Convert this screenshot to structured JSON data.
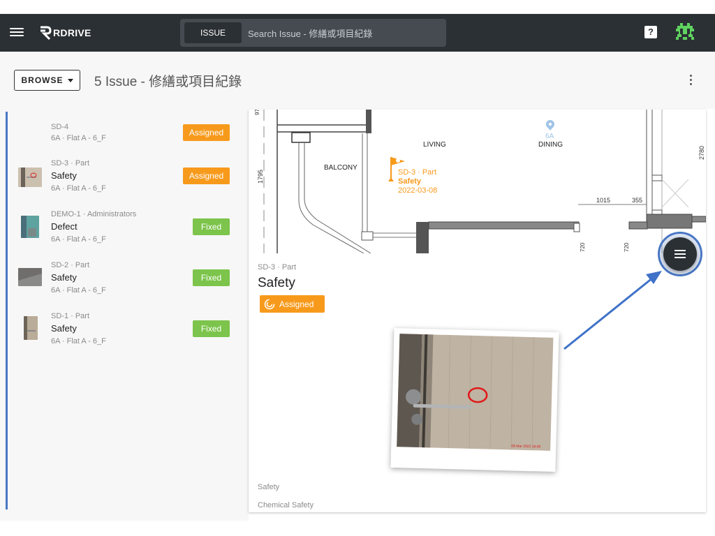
{
  "appbar": {
    "logo_text": "RDRIVE",
    "search_chip": "ISSUE",
    "search_placeholder": "Search Issue - 修繕或項目紀錄",
    "help_label": "?"
  },
  "subheader": {
    "browse_label": "BROWSE",
    "title": "5 Issue - 修繕或項目紀錄"
  },
  "issues": [
    {
      "meta": "SD-4",
      "title": "",
      "location": "6A · Flat A - 6_F",
      "status": "Assigned"
    },
    {
      "meta": "SD-3 · Part",
      "title": "Safety",
      "location": "6A · Flat A - 6_F",
      "status": "Assigned"
    },
    {
      "meta": "DEMO-1 · Administrators",
      "title": "Defect",
      "location": "6A · Flat A - 6_F",
      "status": "Fixed"
    },
    {
      "meta": "SD-2 · Part",
      "title": "Safety",
      "location": "6A · Flat A - 6_F",
      "status": "Fixed"
    },
    {
      "meta": "SD-1 · Part",
      "title": "Safety",
      "location": "6A · Flat A - 6_F",
      "status": "Fixed"
    }
  ],
  "floorplan": {
    "labels": {
      "living": "LIVING",
      "dining": "DINING",
      "balcony": "BALCONY",
      "unit": "6A"
    },
    "dims": {
      "d97": "97",
      "d1795": "1795",
      "d2780": "2780",
      "d1015": "1015",
      "d355": "355",
      "d720a": "720",
      "d720b": "720"
    },
    "marker": {
      "meta": "SD-3 · Part",
      "title": "Safety",
      "date": "2022-03-08"
    }
  },
  "detail": {
    "meta": "SD-3 · Part",
    "title": "Safety",
    "status": "Assigned",
    "photo_stamp": "08 Mar 2022 16:00",
    "field1": "Safety",
    "field2": "Chemical Safety"
  },
  "colors": {
    "appbar": "#2b3034",
    "assigned": "#f79a1c",
    "fixed": "#7cc44b",
    "accent": "#4a77c4"
  },
  "icons": {
    "menu": "hamburger-icon",
    "help": "help-icon",
    "avatar": "pixel-avatar-icon",
    "kebab": "more-vert-icon",
    "fab": "list-menu-icon",
    "status": "progress-icon",
    "marker": "flag-icon"
  }
}
